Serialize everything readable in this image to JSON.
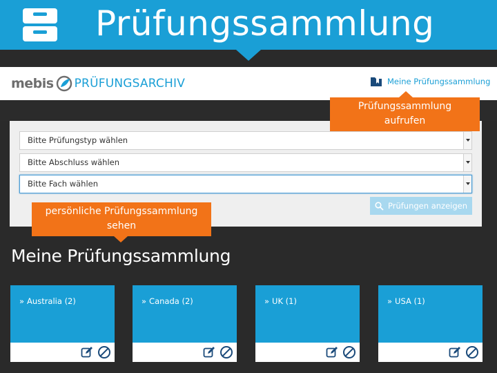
{
  "banner": {
    "title": "Prüfungssammlung",
    "icon": "drawer-cabinet-icon",
    "color": "#1a9fd6"
  },
  "header": {
    "logo_brand": "mebis",
    "logo_product": "PRÜFUNGSARCHIV",
    "my_collection_link": "Meine Prüfungssammlung"
  },
  "filters": {
    "exam_type_placeholder": "Bitte Prüfungstyp wählen",
    "degree_placeholder": "Bitte Abschluss wählen",
    "subject_placeholder": "Bitte Fach wählen",
    "show_button": "Prüfungen anzeigen"
  },
  "callouts": {
    "open_collection_line1": "Prüfungssammlung",
    "open_collection_line2": "aufrufen",
    "view_collection_line1": "persönliche Prüfungssammlung",
    "view_collection_line2": "sehen",
    "color": "#f27318"
  },
  "collection": {
    "title": "Meine Prüfungssammlung",
    "cards": [
      {
        "label": "Australia (2)"
      },
      {
        "label": "Canada (2)"
      },
      {
        "label": "UK (1)"
      },
      {
        "label": "USA (1)"
      }
    ]
  }
}
